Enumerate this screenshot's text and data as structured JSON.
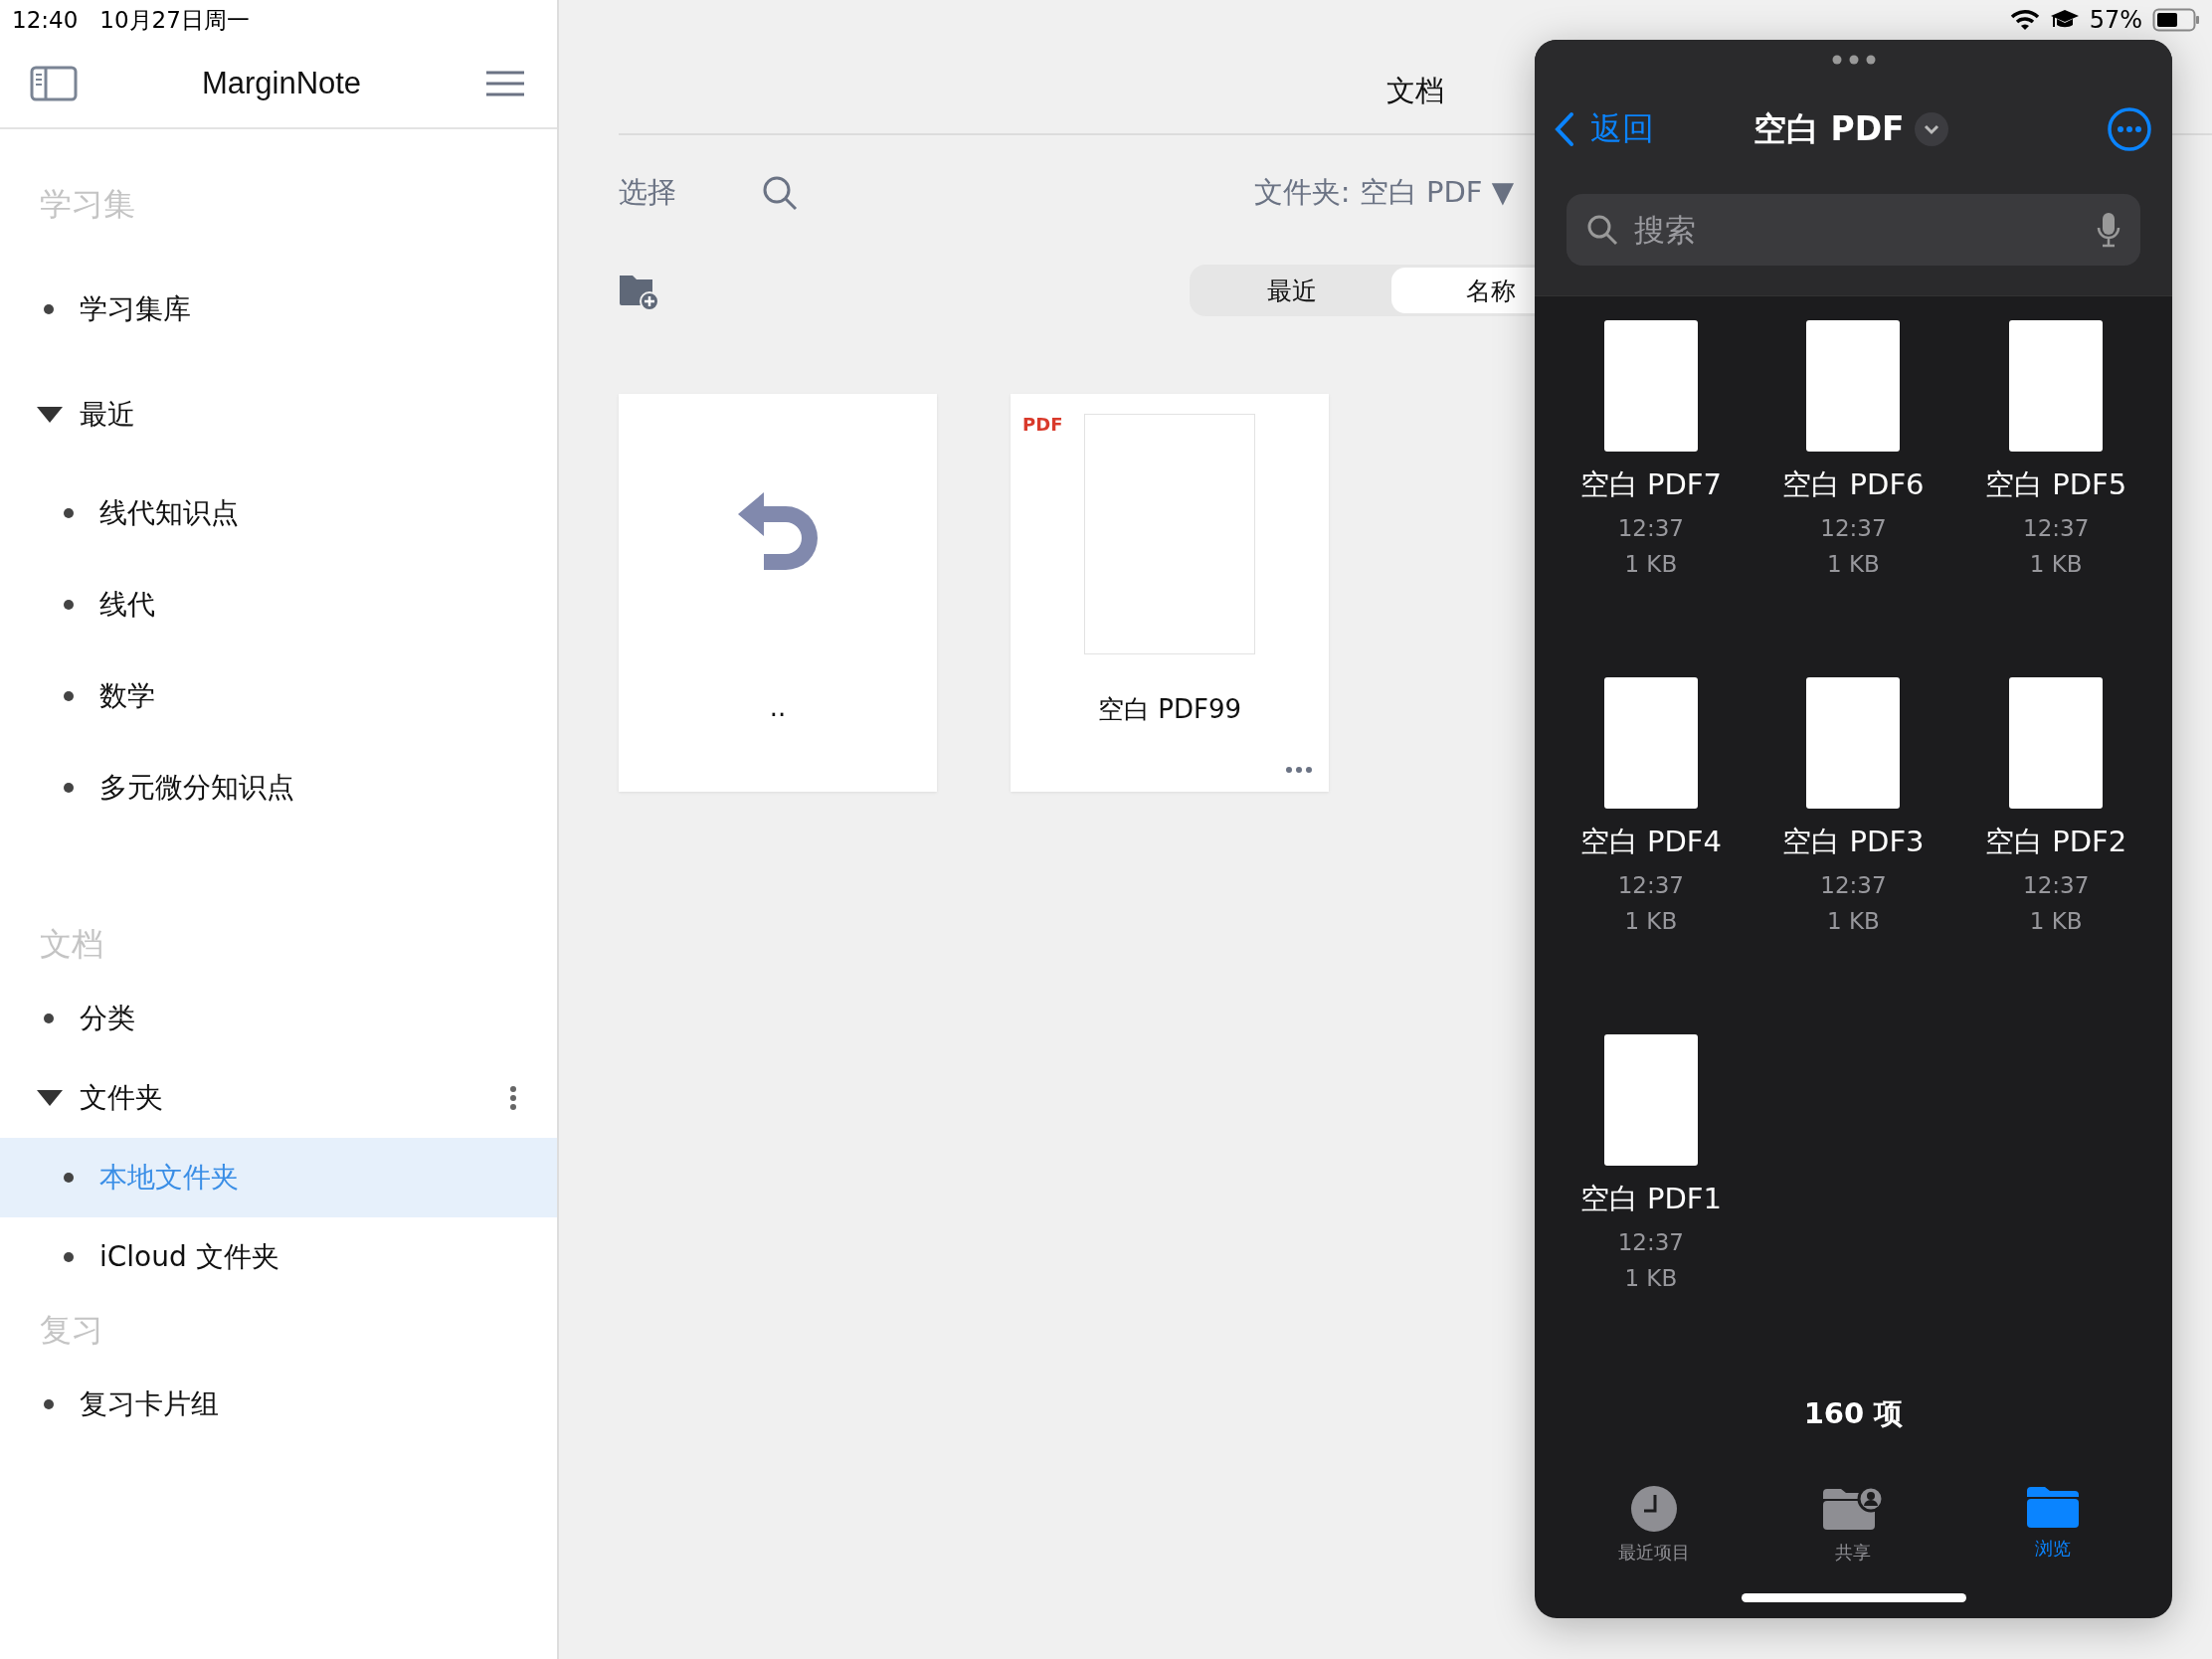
{
  "status_bar": {
    "time": "12:40",
    "date": "10月27日周一",
    "battery": "57%"
  },
  "sidebar": {
    "title": "MarginNote",
    "sections": [
      {
        "heading": "学习集",
        "items": [
          {
            "label": "学习集库",
            "kind": "item",
            "selected": false
          },
          {
            "label": "最近",
            "kind": "group",
            "expanded": true,
            "has_menu": false,
            "children": [
              {
                "label": "线代知识点",
                "selected": false
              },
              {
                "label": "线代",
                "selected": false
              },
              {
                "label": "数学",
                "selected": false
              },
              {
                "label": "多元微分知识点",
                "selected": false
              }
            ]
          }
        ]
      },
      {
        "heading": "文档",
        "items": [
          {
            "label": "分类",
            "kind": "item",
            "selected": false
          },
          {
            "label": "文件夹",
            "kind": "group",
            "expanded": true,
            "has_menu": true,
            "children": [
              {
                "label": "本地文件夹",
                "selected": true
              },
              {
                "label": "iCloud 文件夹",
                "selected": false
              }
            ]
          }
        ]
      },
      {
        "heading": "复习",
        "items": [
          {
            "label": "复习卡片组",
            "kind": "item",
            "selected": false
          }
        ]
      }
    ]
  },
  "documents": {
    "title": "文档",
    "select": "选择",
    "folder": "文件夹: 空白 PDF ▼",
    "sort_tabs": [
      {
        "label": "最近",
        "selected": false
      },
      {
        "label": "名称",
        "selected": true
      }
    ],
    "cards": [
      {
        "kind": "parent",
        "label": ".."
      },
      {
        "kind": "pdf",
        "label": "空白 PDF99",
        "badge": "PDF"
      }
    ]
  },
  "picker": {
    "back": "返回",
    "title": "空白 PDF",
    "search": {
      "placeholder": "搜索"
    },
    "files": [
      {
        "name": "空白 PDF7",
        "time": "12:37",
        "size": "1 KB"
      },
      {
        "name": "空白 PDF6",
        "time": "12:37",
        "size": "1 KB"
      },
      {
        "name": "空白 PDF5",
        "time": "12:37",
        "size": "1 KB"
      },
      {
        "name": "空白 PDF4",
        "time": "12:37",
        "size": "1 KB"
      },
      {
        "name": "空白 PDF3",
        "time": "12:37",
        "size": "1 KB"
      },
      {
        "name": "空白 PDF2",
        "time": "12:37",
        "size": "1 KB"
      },
      {
        "name": "空白 PDF1",
        "time": "12:37",
        "size": "1 KB"
      }
    ],
    "count": "160 项",
    "tabs": [
      {
        "label": "最近项目",
        "kind": "recent",
        "selected": false
      },
      {
        "label": "共享",
        "kind": "shared",
        "selected": false
      },
      {
        "label": "浏览",
        "kind": "browse",
        "selected": true
      }
    ]
  }
}
